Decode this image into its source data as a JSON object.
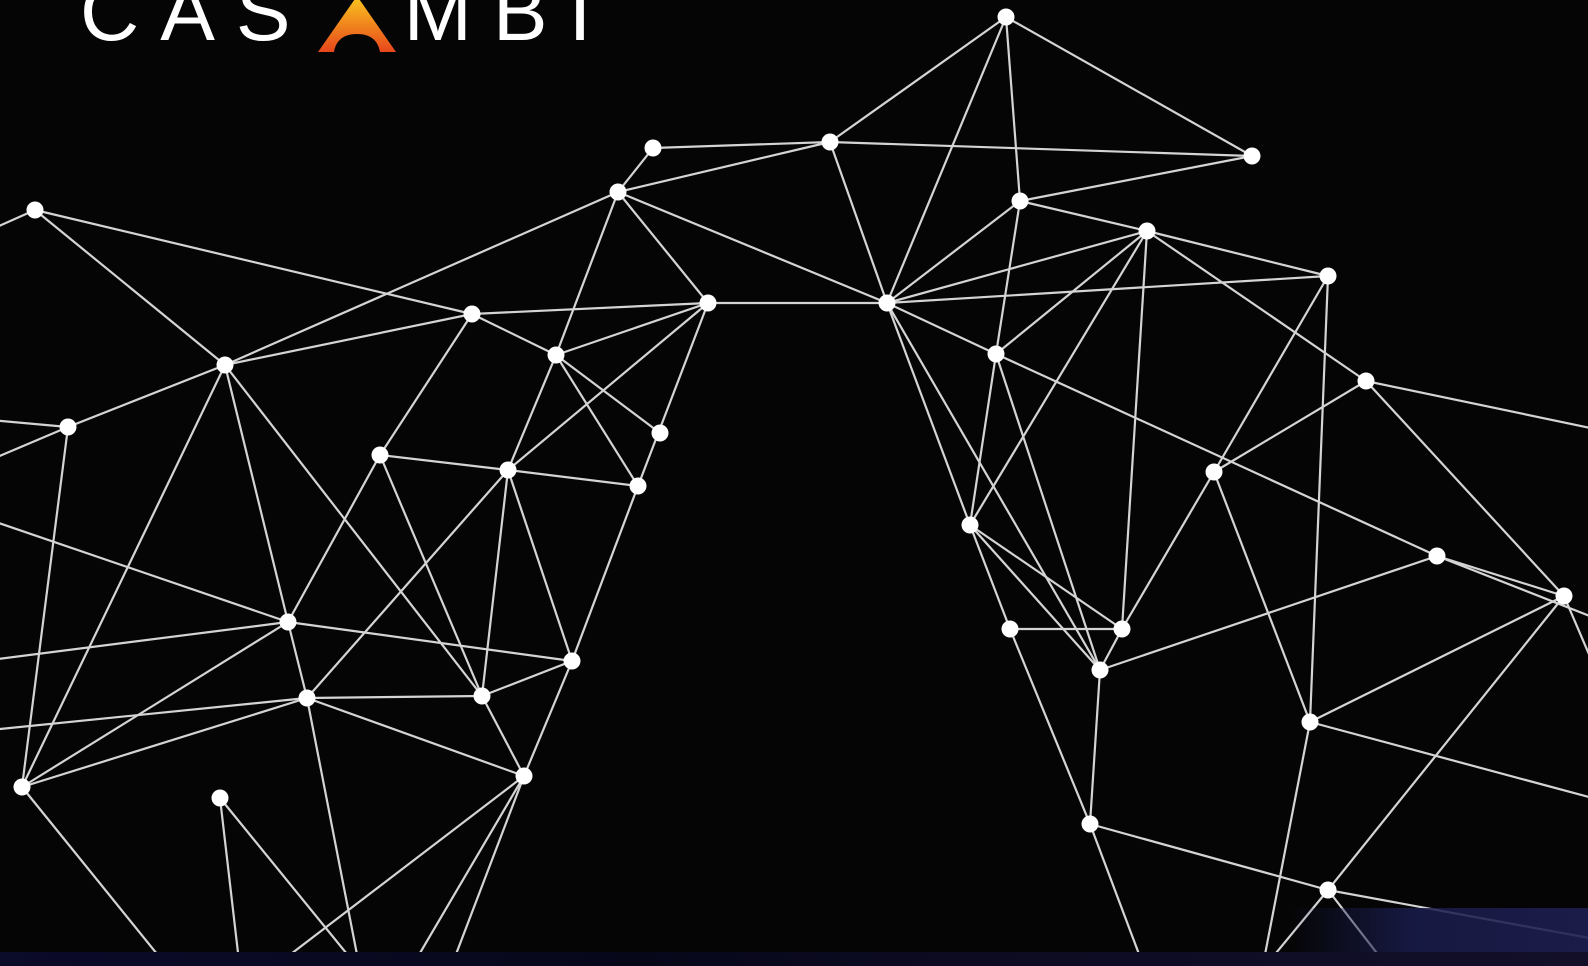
{
  "brand": {
    "logo_left": "CAS",
    "logo_right": "MBI",
    "logo_mark": "A",
    "accent_colors": [
      "#f7b21b",
      "#e8461c"
    ]
  },
  "background": {
    "color": "#050505",
    "line_color": "#e8e8e8",
    "node_color": "#ffffff"
  },
  "network": {
    "icon": "network-graph-illustration"
  }
}
